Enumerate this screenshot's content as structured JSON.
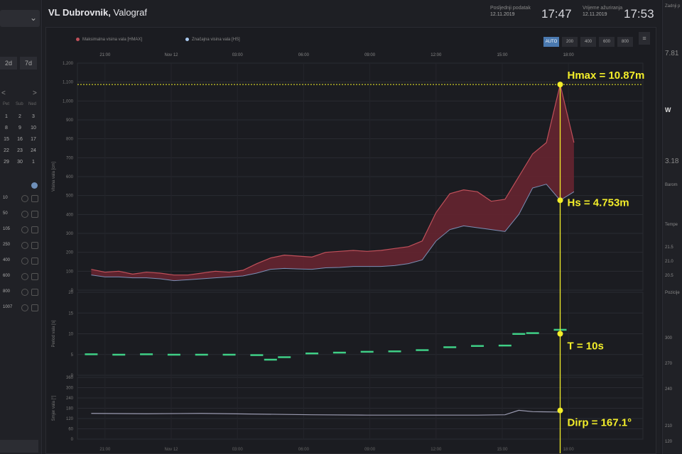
{
  "sidebar": {
    "range_buttons": [
      "2d",
      "7d"
    ],
    "calendar": {
      "nav_prev": "<",
      "nav_next": ">",
      "weekdays": [
        "Pet",
        "Sub",
        "Ned"
      ],
      "days": [
        "1",
        "2",
        "3",
        "8",
        "9",
        "10",
        "15",
        "16",
        "17",
        "22",
        "23",
        "24",
        "29",
        "30",
        "1"
      ]
    },
    "rows": [
      "10",
      "50",
      "105",
      "250",
      "400",
      "600",
      "800",
      "1007"
    ]
  },
  "header": {
    "title_bold": "VL Dubrovnik,",
    "title_rest": " Valograf",
    "last_data_label": "Posljednji podatak",
    "last_data_date": "12.11.2019",
    "last_data_time": "17:47",
    "system_label": "Vrijeme ažuriranja",
    "system_date": "12.11.2019",
    "system_time": "17:53"
  },
  "chart": {
    "legend": [
      {
        "label": "Maksimalna visina vala [HMAX]",
        "color": "#c0505a"
      },
      {
        "label": "Značajna visina vala [HS]",
        "color": "#a9c9ef"
      }
    ],
    "zoom_buttons": [
      "AUTO",
      "200",
      "400",
      "600",
      "800"
    ],
    "menu_icon": "≡",
    "top_time_labels": [
      "21:00",
      "Nov 12",
      "03:00",
      "06:00",
      "09:00",
      "12:00",
      "15:00",
      "18:00"
    ],
    "bottom_time_labels": [
      "21:00",
      "Nov 12",
      "03:00",
      "06:00",
      "09:00",
      "12:00",
      "15:00",
      "18:00"
    ],
    "annotations": {
      "hmax": "Hmax = 10.87m",
      "hs": "Hs = 4.753m",
      "t": "T = 10s",
      "dirp": "Dirp = 167.1°"
    },
    "colors": {
      "hmax": "#c0505a",
      "hs": "#a9c9ef",
      "period": "#3fcf86",
      "direction": "#9a9ab0",
      "annotation": "#f3ee2a"
    }
  },
  "chart_data": [
    {
      "type": "area",
      "ylabel": "Visina vala [cm]",
      "yticks": [
        0,
        100,
        200,
        300,
        400,
        500,
        600,
        700,
        800,
        900,
        1000,
        1100,
        1200
      ],
      "ylim": [
        0,
        1200
      ],
      "x": [
        0,
        0.5,
        1.0,
        1.5,
        2.0,
        2.5,
        3.0,
        3.5,
        4.0,
        4.5,
        5.0,
        5.5,
        6.0,
        6.5,
        7.0,
        7.5,
        8.0,
        8.5,
        9.0,
        9.5,
        10.0,
        10.5,
        11.0,
        11.5,
        12.0,
        12.5,
        13.0,
        13.5,
        14.0,
        14.5,
        15.0,
        15.5,
        16.0,
        16.5,
        17.0,
        17.5
      ],
      "series": [
        {
          "name": "Maksimalna visina vala [HMAX]",
          "values": [
            110,
            95,
            100,
            85,
            95,
            90,
            80,
            80,
            90,
            100,
            95,
            105,
            140,
            170,
            185,
            180,
            175,
            200,
            205,
            210,
            205,
            210,
            220,
            230,
            260,
            410,
            510,
            530,
            520,
            470,
            480,
            600,
            720,
            780,
            1087,
            780
          ]
        },
        {
          "name": "Značajna visina vala [HS]",
          "values": [
            80,
            70,
            70,
            65,
            65,
            60,
            50,
            55,
            60,
            65,
            70,
            75,
            90,
            110,
            115,
            112,
            110,
            118,
            120,
            125,
            125,
            125,
            130,
            140,
            160,
            260,
            320,
            340,
            330,
            320,
            310,
            400,
            540,
            560,
            475,
            520
          ]
        }
      ]
    },
    {
      "type": "scatter",
      "ylabel": "Period vala [s]",
      "yticks": [
        0,
        5,
        10,
        15,
        20
      ],
      "ylim": [
        0,
        20
      ],
      "x": [
        0,
        1,
        2,
        3,
        4,
        5,
        6,
        6.5,
        7,
        8,
        9,
        10,
        11,
        12,
        13,
        14,
        15,
        15.5,
        16,
        17
      ],
      "series": [
        {
          "name": "Period vala [s]",
          "values": [
            5.1,
            5.0,
            5.1,
            5.0,
            5.0,
            5.0,
            4.9,
            3.8,
            4.4,
            5.3,
            5.5,
            5.7,
            5.8,
            6.1,
            6.8,
            7.1,
            7.2,
            10.0,
            10.2,
            11.0
          ]
        }
      ]
    },
    {
      "type": "line",
      "ylabel": "Smjer vala [°]",
      "yticks": [
        0,
        60,
        120,
        180,
        240,
        300,
        360
      ],
      "ylim": [
        0,
        360
      ],
      "x": [
        0,
        2,
        4,
        6,
        8,
        10,
        12,
        14,
        15,
        15.5,
        16,
        17
      ],
      "series": [
        {
          "name": "Smjer vala [°]",
          "values": [
            150,
            148,
            150,
            146,
            142,
            140,
            140,
            140,
            142,
            168,
            160,
            158
          ]
        }
      ]
    }
  ],
  "rightbar": {
    "labels": [
      "Zadnji p",
      "7.81",
      "W",
      "3.18",
      "Barom",
      "Tempe",
      "21.5",
      "21.0",
      "20.5",
      "Pozicije",
      "300",
      "270",
      "240",
      "210",
      "120"
    ]
  }
}
